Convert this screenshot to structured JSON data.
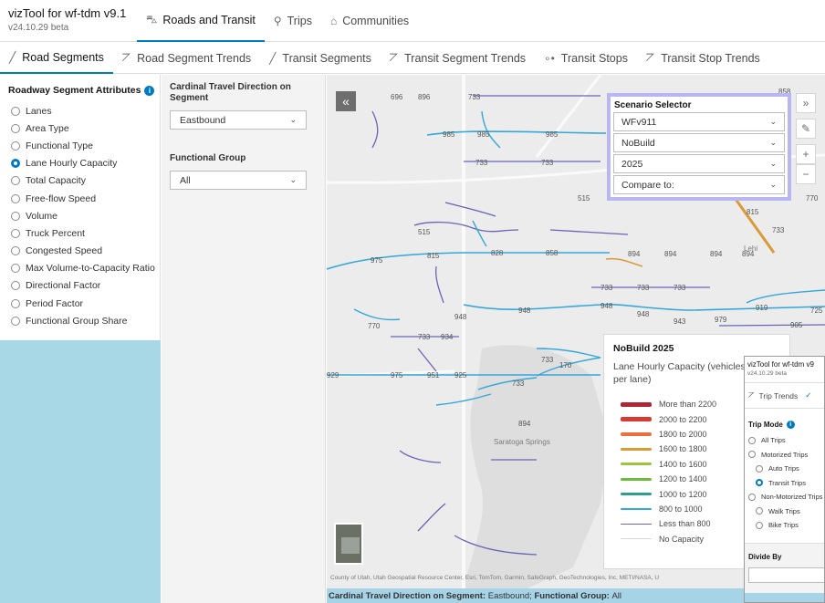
{
  "header": {
    "title": "vizTool for wf-tdm v9.1",
    "version": "v24.10.29 beta",
    "tabs": [
      {
        "label": "Roads and Transit",
        "icon": "road-icon",
        "active": true
      },
      {
        "label": "Trips",
        "icon": "trips-icon",
        "active": false
      },
      {
        "label": "Communities",
        "icon": "communities-icon",
        "active": false
      }
    ]
  },
  "subtabs": [
    {
      "label": "Road Segments",
      "icon": "line-icon",
      "active": true
    },
    {
      "label": "Road Segment Trends",
      "icon": "trend-chart-icon",
      "active": false
    },
    {
      "label": "Transit Segments",
      "icon": "line-icon",
      "active": false
    },
    {
      "label": "Transit Segment Trends",
      "icon": "trend-chart-icon",
      "active": false
    },
    {
      "label": "Transit Stops",
      "icon": "stops-icon",
      "active": false
    },
    {
      "label": "Transit Stop Trends",
      "icon": "trend-chart-icon",
      "active": false
    }
  ],
  "attributes": {
    "title": "Roadway Segment Attributes",
    "items": [
      "Lanes",
      "Area Type",
      "Functional Type",
      "Lane Hourly Capacity",
      "Total Capacity",
      "Free-flow Speed",
      "Volume",
      "Truck Percent",
      "Congested Speed",
      "Max Volume-to-Capacity Ratio",
      "Directional Factor",
      "Period Factor",
      "Functional Group Share"
    ],
    "selected": "Lane Hourly Capacity"
  },
  "filters": {
    "direction_label": "Cardinal Travel Direction on Segment",
    "direction_value": "Eastbound",
    "group_label": "Functional Group",
    "group_value": "All"
  },
  "scenario": {
    "title": "Scenario Selector",
    "model": "WFv911",
    "scenario": "NoBuild",
    "year": "2025",
    "compare_placeholder": "Compare to:"
  },
  "legend": {
    "title": "NoBuild 2025",
    "subtitle": "Lane Hourly Capacity (vehicles per lane)",
    "items": [
      {
        "label": "More than 2200",
        "color": "#b02535",
        "width": 5
      },
      {
        "label": "2000 to 2200",
        "color": "#d63a33",
        "width": 4.5
      },
      {
        "label": "1800 to 2000",
        "color": "#e8713f",
        "width": 4
      },
      {
        "label": "1600 to 1800",
        "color": "#d99a38",
        "width": 3.5
      },
      {
        "label": "1400 to 1600",
        "color": "#9cc43f",
        "width": 3
      },
      {
        "label": "1200 to 1400",
        "color": "#6cbb3b",
        "width": 3
      },
      {
        "label": "1000 to 1200",
        "color": "#2e9e8f",
        "width": 2.5
      },
      {
        "label": "800 to 1000",
        "color": "#35a7d9",
        "width": 2
      },
      {
        "label": "Less than 800",
        "color": "#6b63b5",
        "width": 1.5
      },
      {
        "label": "No Capacity",
        "color": "#d9d9d9",
        "width": 1
      }
    ]
  },
  "map": {
    "road_labels": [
      "733",
      "985",
      "985",
      "985",
      "733",
      "733",
      "515",
      "515",
      "828",
      "858",
      "894",
      "894",
      "894",
      "894",
      "975",
      "815",
      "733",
      "733",
      "733",
      "948",
      "948",
      "948",
      "948",
      "943",
      "979",
      "919",
      "725",
      "905",
      "770",
      "733",
      "934",
      "929",
      "975",
      "951",
      "925",
      "733",
      "894",
      "733",
      "170",
      "696",
      "896",
      "858",
      "815",
      "733",
      "770"
    ],
    "place_labels": [
      "Lehi",
      "Saratoga Springs"
    ],
    "attribution": "County of Utah, Utah Geospatial Resource Center, Esri, TomTom, Garmin, SafeGraph, GeoTechnologies, Inc, METI/NASA, U"
  },
  "status": {
    "direction_label": "Cardinal Travel Direction on Segment:",
    "direction_value": "Eastbound;",
    "group_label": "Functional Group:",
    "group_value": "All"
  },
  "inset": {
    "title": "vizTool for wf-tdm v9",
    "version": "v24.10.29 beta",
    "tab": "Trip Trends",
    "mode_label": "Trip Mode",
    "modes": [
      "All Trips",
      "Motorized Trips",
      "Auto Trips",
      "Transit Trips",
      "Non-Motorized Trips",
      "Walk Trips",
      "Bike Trips"
    ],
    "selected_mode": "Transit Trips",
    "divide_label": "Divide By"
  }
}
